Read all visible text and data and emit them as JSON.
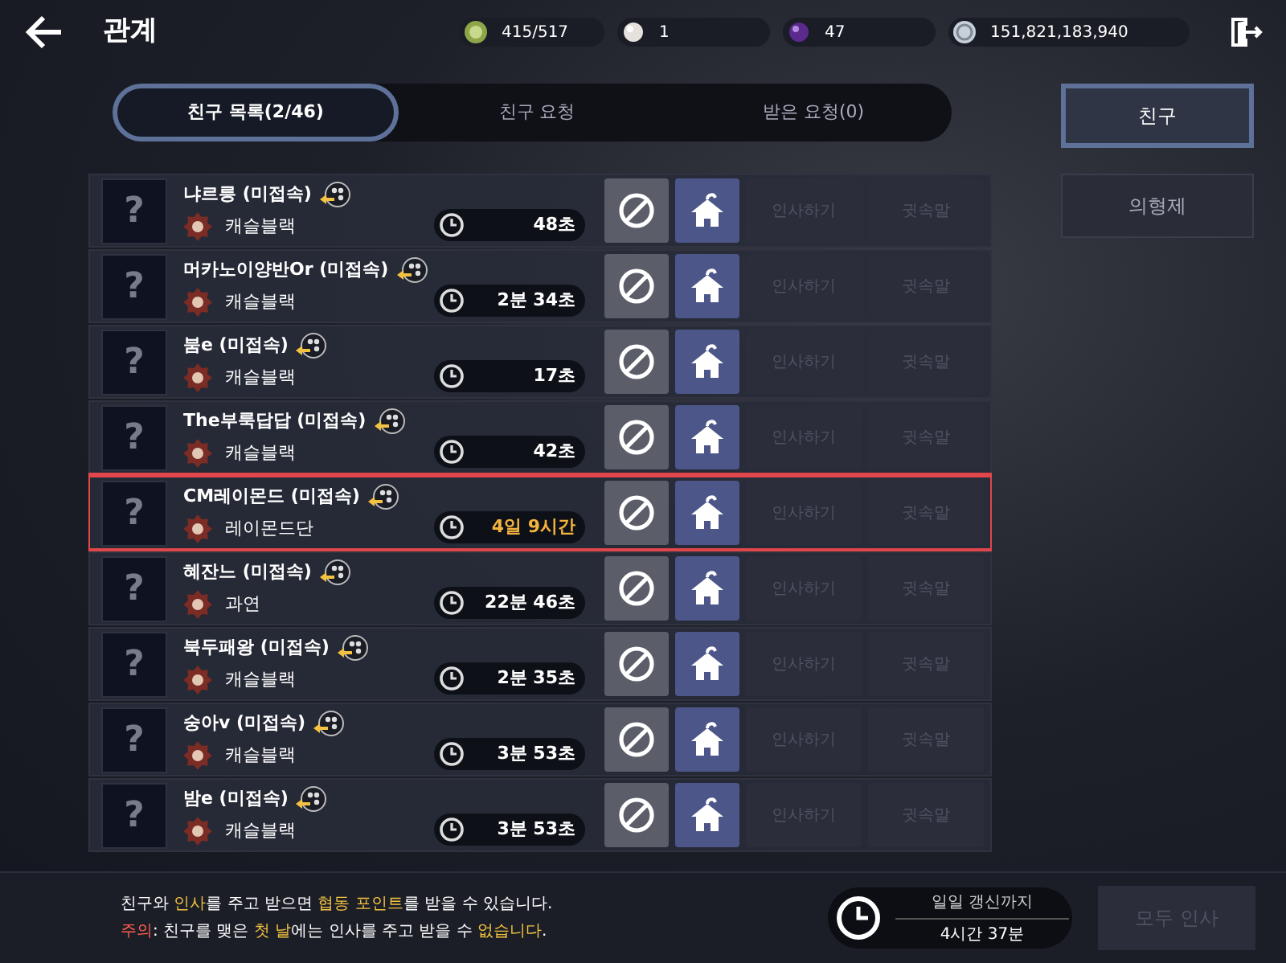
{
  "header": {
    "title": "관계",
    "currencies": [
      {
        "kind": "stamina",
        "value": "415/517"
      },
      {
        "kind": "pearl",
        "value": "1"
      },
      {
        "kind": "orb",
        "value": "47"
      },
      {
        "kind": "silver",
        "value": "151,821,183,940"
      }
    ]
  },
  "tabs": [
    {
      "label": "친구 목록(2/46)",
      "selected": true
    },
    {
      "label": "친구 요청",
      "selected": false
    },
    {
      "label": "받은 요청(0)",
      "selected": false
    }
  ],
  "side_tabs": [
    {
      "label": "친구",
      "selected": true
    },
    {
      "label": "의형제",
      "selected": false
    }
  ],
  "friends": [
    {
      "name": "냐르릉 (미접속)",
      "guild": "캐슬블랙",
      "last_seen": "48초",
      "highlighted": false,
      "recent": false,
      "greet": "인사하기",
      "whisper": "귓속말"
    },
    {
      "name": "머카노이양반Or (미접속)",
      "guild": "캐슬블랙",
      "last_seen": "2분 34초",
      "highlighted": false,
      "recent": false,
      "greet": "인사하기",
      "whisper": "귓속말"
    },
    {
      "name": "붐e (미접속)",
      "guild": "캐슬블랙",
      "last_seen": "17초",
      "highlighted": false,
      "recent": false,
      "greet": "인사하기",
      "whisper": "귓속말"
    },
    {
      "name": "The부룩답답 (미접속)",
      "guild": "캐슬블랙",
      "last_seen": "42초",
      "highlighted": false,
      "recent": false,
      "greet": "인사하기",
      "whisper": "귓속말"
    },
    {
      "name": "CM레이몬드 (미접속)",
      "guild": "레이몬드단",
      "last_seen": "4일 9시간",
      "highlighted": true,
      "recent": true,
      "greet": "인사하기",
      "whisper": "귓속말"
    },
    {
      "name": "혜잔느 (미접속)",
      "guild": "과연",
      "last_seen": "22분 46초",
      "highlighted": false,
      "recent": false,
      "greet": "인사하기",
      "whisper": "귓속말"
    },
    {
      "name": "북두패왕 (미접속)",
      "guild": "캐슬블랙",
      "last_seen": "2분 35초",
      "highlighted": false,
      "recent": false,
      "greet": "인사하기",
      "whisper": "귓속말"
    },
    {
      "name": "숭아v (미접속)",
      "guild": "캐슬블랙",
      "last_seen": "3분 53초",
      "highlighted": false,
      "recent": false,
      "greet": "인사하기",
      "whisper": "귓속말"
    },
    {
      "name": "밤e (미접속)",
      "guild": "캐슬블랙",
      "last_seen": "3분 53초",
      "highlighted": false,
      "recent": false,
      "greet": "인사하기",
      "whisper": "귓속말"
    }
  ],
  "row_buttons": {
    "disabled": true
  },
  "avatar_text": "?",
  "notes": [
    [
      {
        "text": "친구와 ",
        "kind": "plain"
      },
      {
        "text": "인사",
        "kind": "highlight"
      },
      {
        "text": "를 주고 받으면 ",
        "kind": "plain"
      },
      {
        "text": "협동 포인트",
        "kind": "highlight"
      },
      {
        "text": "를 받을 수 있습니다.",
        "kind": "plain"
      }
    ],
    [
      {
        "text": "주의",
        "kind": "warning"
      },
      {
        "text": ": 친구를 맺은 ",
        "kind": "plain"
      },
      {
        "text": "첫 날",
        "kind": "highlight"
      },
      {
        "text": "에는 인사를 주고 받을 수 ",
        "kind": "plain"
      },
      {
        "text": "없습니다",
        "kind": "highlight"
      },
      {
        "text": ".",
        "kind": "plain"
      }
    ]
  ],
  "daily_reset": {
    "label": "일일 갱신까지",
    "value": "4시간 37분"
  },
  "greet_all": {
    "label": "모두 인사",
    "disabled": true
  }
}
